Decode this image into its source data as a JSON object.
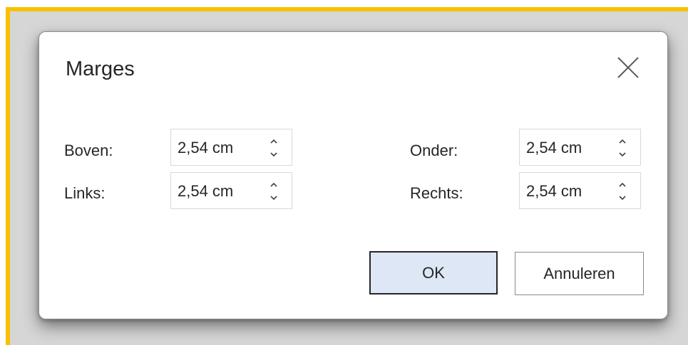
{
  "dialog": {
    "title": "Marges",
    "close_icon": "close-icon"
  },
  "fields": {
    "top": {
      "label": "Boven:",
      "value": "2,54 cm"
    },
    "bottom": {
      "label": "Onder:",
      "value": "2,54 cm"
    },
    "left": {
      "label": "Links:",
      "value": "2,54 cm"
    },
    "right": {
      "label": "Rechts:",
      "value": "2,54 cm"
    }
  },
  "buttons": {
    "ok_label": "OK",
    "cancel_label": "Annuleren"
  },
  "colors": {
    "backdrop": "#d6d6d6",
    "highlight_border": "#f8c100",
    "ok_button_bg": "#dde7f6",
    "text": "#262626"
  }
}
